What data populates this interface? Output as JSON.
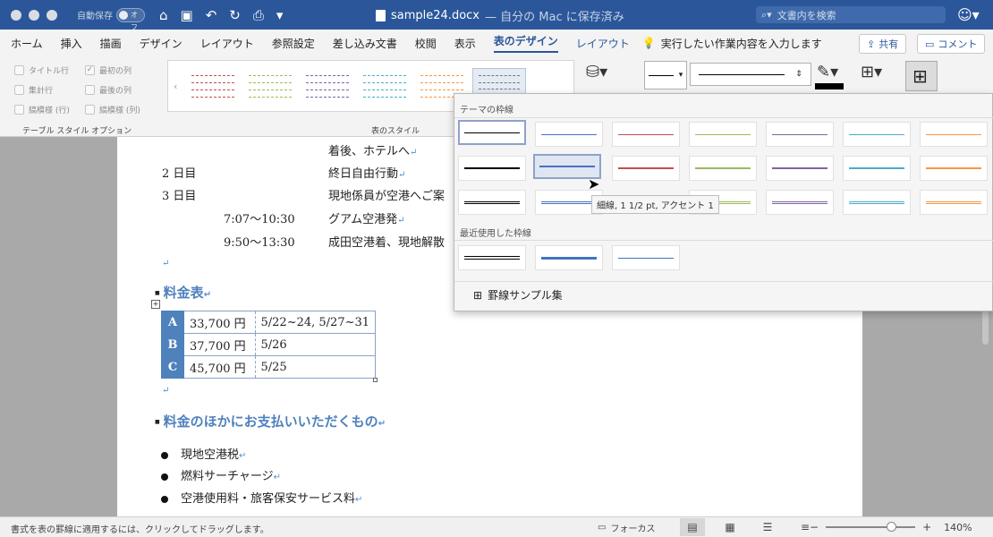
{
  "titlebar": {
    "autosave_label": "自動保存",
    "autosave_state": "オフ",
    "doc_name": "sample24.docx",
    "doc_location": "— 自分の Mac に保存済み",
    "search_placeholder": "文書内を検索"
  },
  "tabs": [
    "ホーム",
    "挿入",
    "描画",
    "デザイン",
    "レイアウト",
    "参照設定",
    "差し込み文書",
    "校閲",
    "表示"
  ],
  "active_tab": "表のデザイン",
  "layout_tab": "レイアウト",
  "tell_me": "実行したい作業内容を入力します",
  "share": "共有",
  "comment": "コメント",
  "options": {
    "header_row": "タイトル行",
    "first_col": "最初の列",
    "total_row": "集計行",
    "last_col": "最後の列",
    "banded_rows": "縞模様 (行)",
    "banded_cols": "縞模様 (列)",
    "group_label": "テーブル スタイル オプション"
  },
  "styles_label": "表のスタイル",
  "document": {
    "line1": "着後、ホテルへ",
    "day2": "2 日目",
    "day2_text": "終日自由行動",
    "day3": "3 日目",
    "day3_text": "現地係員が空港へご案",
    "t1": "7:07～10:30",
    "t1_text": "グアム空港発",
    "t2": "9:50～13:30",
    "t2_text": "成田空港着、現地解散",
    "heading1": "料金表",
    "heading2": "料金のほかにお支払いいただくもの",
    "table": [
      {
        "label": "A",
        "price": "33,700 円",
        "dates": "5/22~24, 5/27~31"
      },
      {
        "label": "B",
        "price": "37,700 円",
        "dates": "5/26"
      },
      {
        "label": "C",
        "price": "45,700 円",
        "dates": "5/25"
      }
    ],
    "bullets": [
      "現地空港税",
      "燃料サーチャージ",
      "空港使用料・旅客保安サービス料"
    ]
  },
  "popup": {
    "theme_header": "テーマの枠線",
    "recent_header": "最近使用した枠線",
    "tooltip": "細線, 1 1/2 pt, アクセント 1",
    "sample_link": "罫線サンプル集"
  },
  "status": {
    "message": "書式を表の罫線に適用するには、クリックしてドラッグします。",
    "focus": "フォーカス",
    "zoom": "140%"
  },
  "colors": {
    "accent_blue": "#2b579a",
    "heading_blue": "#4f81bd",
    "theme_lines": [
      "#000000",
      "#4472c4",
      "#c0504d",
      "#9bbb59",
      "#8064a2",
      "#4bacc6",
      "#f79646"
    ]
  }
}
